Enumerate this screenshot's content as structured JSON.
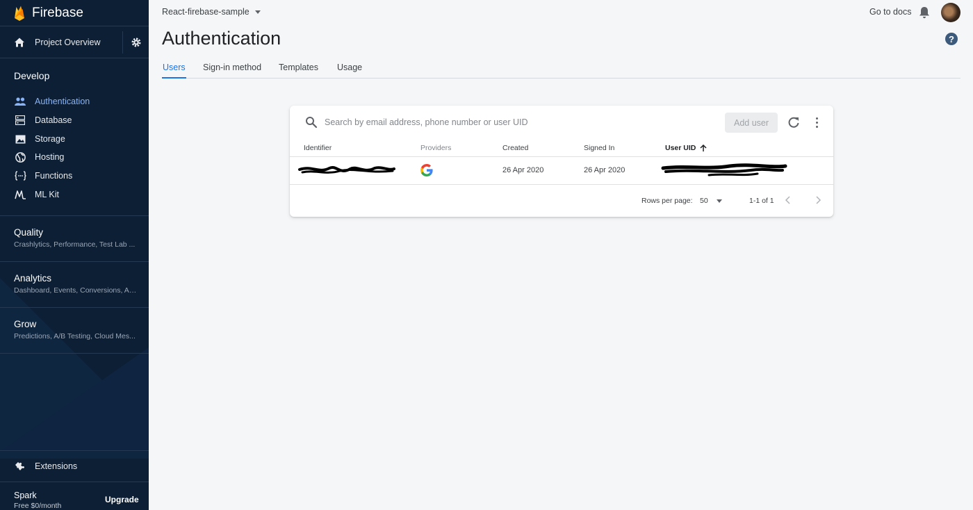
{
  "sidebar": {
    "brand": "Firebase",
    "project_overview": "Project Overview",
    "develop": {
      "title": "Develop",
      "items": [
        {
          "label": "Authentication",
          "icon": "people-icon",
          "active": true
        },
        {
          "label": "Database",
          "icon": "database-icon"
        },
        {
          "label": "Storage",
          "icon": "image-icon"
        },
        {
          "label": "Hosting",
          "icon": "globe-icon"
        },
        {
          "label": "Functions",
          "icon": "functions-icon"
        },
        {
          "label": "ML Kit",
          "icon": "ml-kit-icon"
        }
      ]
    },
    "groups": [
      {
        "title": "Quality",
        "subtitle": "Crashlytics, Performance, Test Lab ..."
      },
      {
        "title": "Analytics",
        "subtitle": "Dashboard, Events, Conversions, Au..."
      },
      {
        "title": "Grow",
        "subtitle": "Predictions, A/B Testing, Cloud Mes..."
      }
    ],
    "extensions": "Extensions",
    "plan": {
      "name": "Spark",
      "price": "Free $0/month",
      "upgrade": "Upgrade"
    }
  },
  "header": {
    "project": "React-firebase-sample",
    "docs": "Go to docs",
    "help": "?",
    "title": "Authentication",
    "tabs": [
      {
        "label": "Users",
        "active": true
      },
      {
        "label": "Sign-in method"
      },
      {
        "label": "Templates"
      },
      {
        "label": "Usage"
      }
    ]
  },
  "users_table": {
    "search_placeholder": "Search by email address, phone number or user UID",
    "add_user": "Add user",
    "columns": [
      "Identifier",
      "Providers",
      "Created",
      "Signed In",
      "User UID"
    ],
    "rows": [
      {
        "identifier": "",
        "provider": "google-icon",
        "created": "26 Apr 2020",
        "signed_in": "26 Apr 2020",
        "uid": ""
      }
    ],
    "rows_per_page_label": "Rows per page:",
    "rows_per_page": "50",
    "range": "1-1 of 1"
  },
  "colors": {
    "sidebar_bg": "#0c1f35",
    "accent": "#1a73e8",
    "page_bg": "#f5f6f8",
    "firebase_yellow": "#ffca28",
    "firebase_orange": "#f57c00"
  }
}
